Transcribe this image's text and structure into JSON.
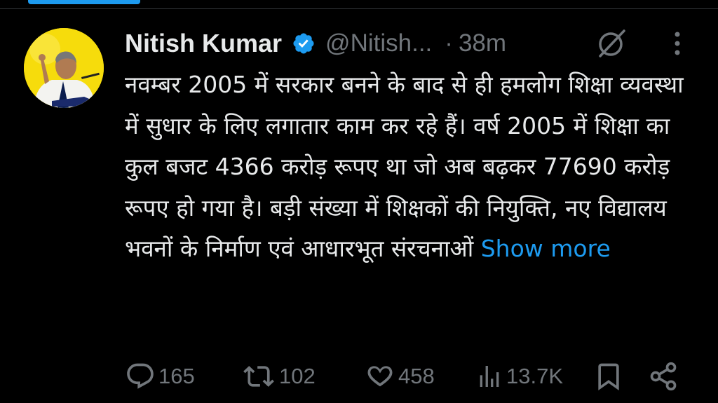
{
  "author": {
    "name": "Nitish Kumar",
    "handle": "@Nitish...",
    "separator": "·",
    "time": "38m"
  },
  "tweet": {
    "text": "नवम्बर 2005 में सरकार बनने के बाद से ही हमलोग शिक्षा व्यवस्था में सुधार के लिए लगातार काम कर रहे हैं। वर्ष 2005 में शिक्षा का कुल बजट 4366 करोड़ रूपए था जो अब बढ़कर 77690 करोड़ रूपए हो गया है। बड़ी संख्या में शिक्षकों की नियुक्ति, नए विद्यालय भवनों के निर्माण एवं आधारभूत संरचनाओं",
    "show_more": "Show more"
  },
  "actions": {
    "replies": "165",
    "reposts": "102",
    "likes": "458",
    "views": "13.7K"
  },
  "colors": {
    "background": "#000000",
    "text": "#e7e9ea",
    "muted": "#71767b",
    "accent": "#1d9bf0"
  },
  "icons": [
    "verified-badge-icon",
    "grok-icon",
    "more-options-icon",
    "reply-icon",
    "repost-icon",
    "like-icon",
    "views-icon",
    "bookmark-icon",
    "share-icon"
  ]
}
